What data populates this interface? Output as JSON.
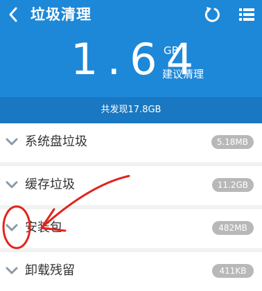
{
  "header": {
    "title": "垃圾清理",
    "size_value": "1.64",
    "size_unit": "GB",
    "suggestion": "建议清理",
    "summary": "共发现17.8GB",
    "background_color": "#1e88d8",
    "summary_color": "#1978c1"
  },
  "icons": {
    "back": "chevron-left-icon",
    "refresh": "refresh-icon",
    "menu": "list-menu-icon"
  },
  "items": [
    {
      "label": "系统盘垃圾",
      "size": "5.18MB"
    },
    {
      "label": "缓存垃圾",
      "size": "11.2GB"
    },
    {
      "label": "安装包",
      "size": "482MB"
    },
    {
      "label": "卸载残留",
      "size": "411KB"
    }
  ],
  "annotation": {
    "color": "#e0241c",
    "marks": [
      "red-circle",
      "red-arrow"
    ]
  }
}
